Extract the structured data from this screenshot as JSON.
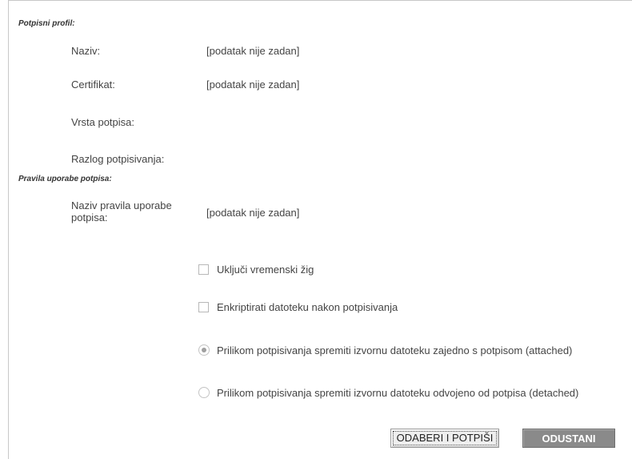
{
  "signing_profile": {
    "section_title": "Potpisni profil:",
    "fields": [
      {
        "label": "Naziv:",
        "value": "[podatak nije zadan]"
      },
      {
        "label": "Certifikat:",
        "value": "[podatak nije zadan]"
      },
      {
        "label": "Vrsta potpisa:",
        "value": ""
      },
      {
        "label": "Razlog potpisivanja:",
        "value": ""
      }
    ]
  },
  "usage_rules": {
    "section_title": "Pravila uporabe potpisa:",
    "label_line1": "Naziv pravila uporabe",
    "label_line2": "potpisa:",
    "value": "[podatak nije zadan]"
  },
  "options": {
    "timestamp": {
      "label": "Uključi vremenski žig",
      "checked": false
    },
    "encrypt": {
      "label": "Enkriptirati datoteku nakon potpisivanja",
      "checked": false
    },
    "attached": {
      "label": "Prilikom potpisivanja spremiti izvornu datoteku zajedno s potpisom (attached)",
      "selected": true
    },
    "detached": {
      "label": "Prilikom potpisivanja spremiti izvornu datoteku odvojeno od potpisa (detached)",
      "selected": false
    }
  },
  "buttons": {
    "select_and_sign": "ODABERI I POTPIŠI",
    "cancel": "ODUSTANI"
  }
}
